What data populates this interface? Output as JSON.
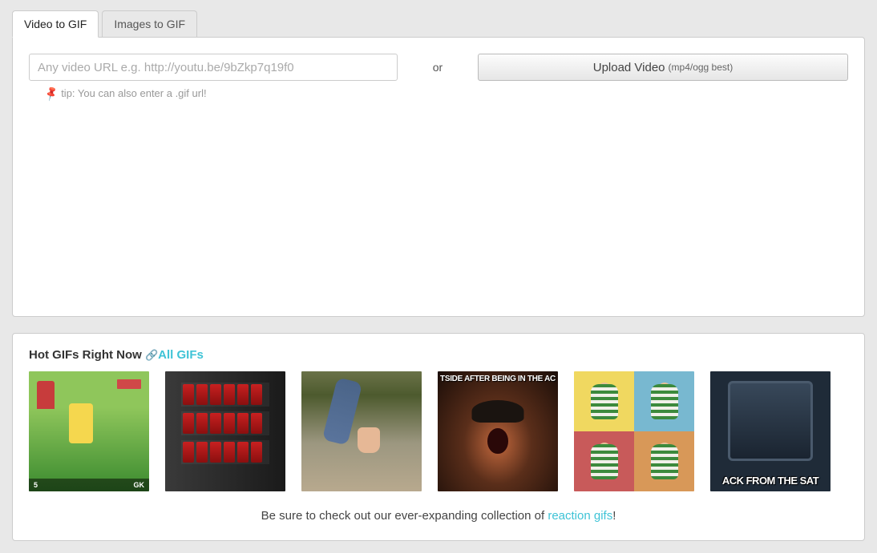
{
  "tabs": {
    "video": "Video to GIF",
    "images": "Images to GIF"
  },
  "input": {
    "placeholder": "Any video URL e.g. http://youtu.be/9bZkp7q19f0",
    "or": "or",
    "upload_label": "Upload Video",
    "upload_hint": "(mp4/ogg best)",
    "tip": "tip: You can also enter a .gif url!"
  },
  "hot": {
    "title": "Hot GIFs Right Now ",
    "all_link": "All GIFs",
    "thumbs": {
      "t1_strip_left": "5",
      "t1_strip_right": "GK",
      "t4_caption": "TSIDE AFTER BEING IN THE AC",
      "t6_caption": "ACK FROM THE SAT"
    }
  },
  "footer": {
    "lead": "Be sure to check out our ever-expanding collection of ",
    "link": "reaction gifs",
    "tail": "!"
  }
}
